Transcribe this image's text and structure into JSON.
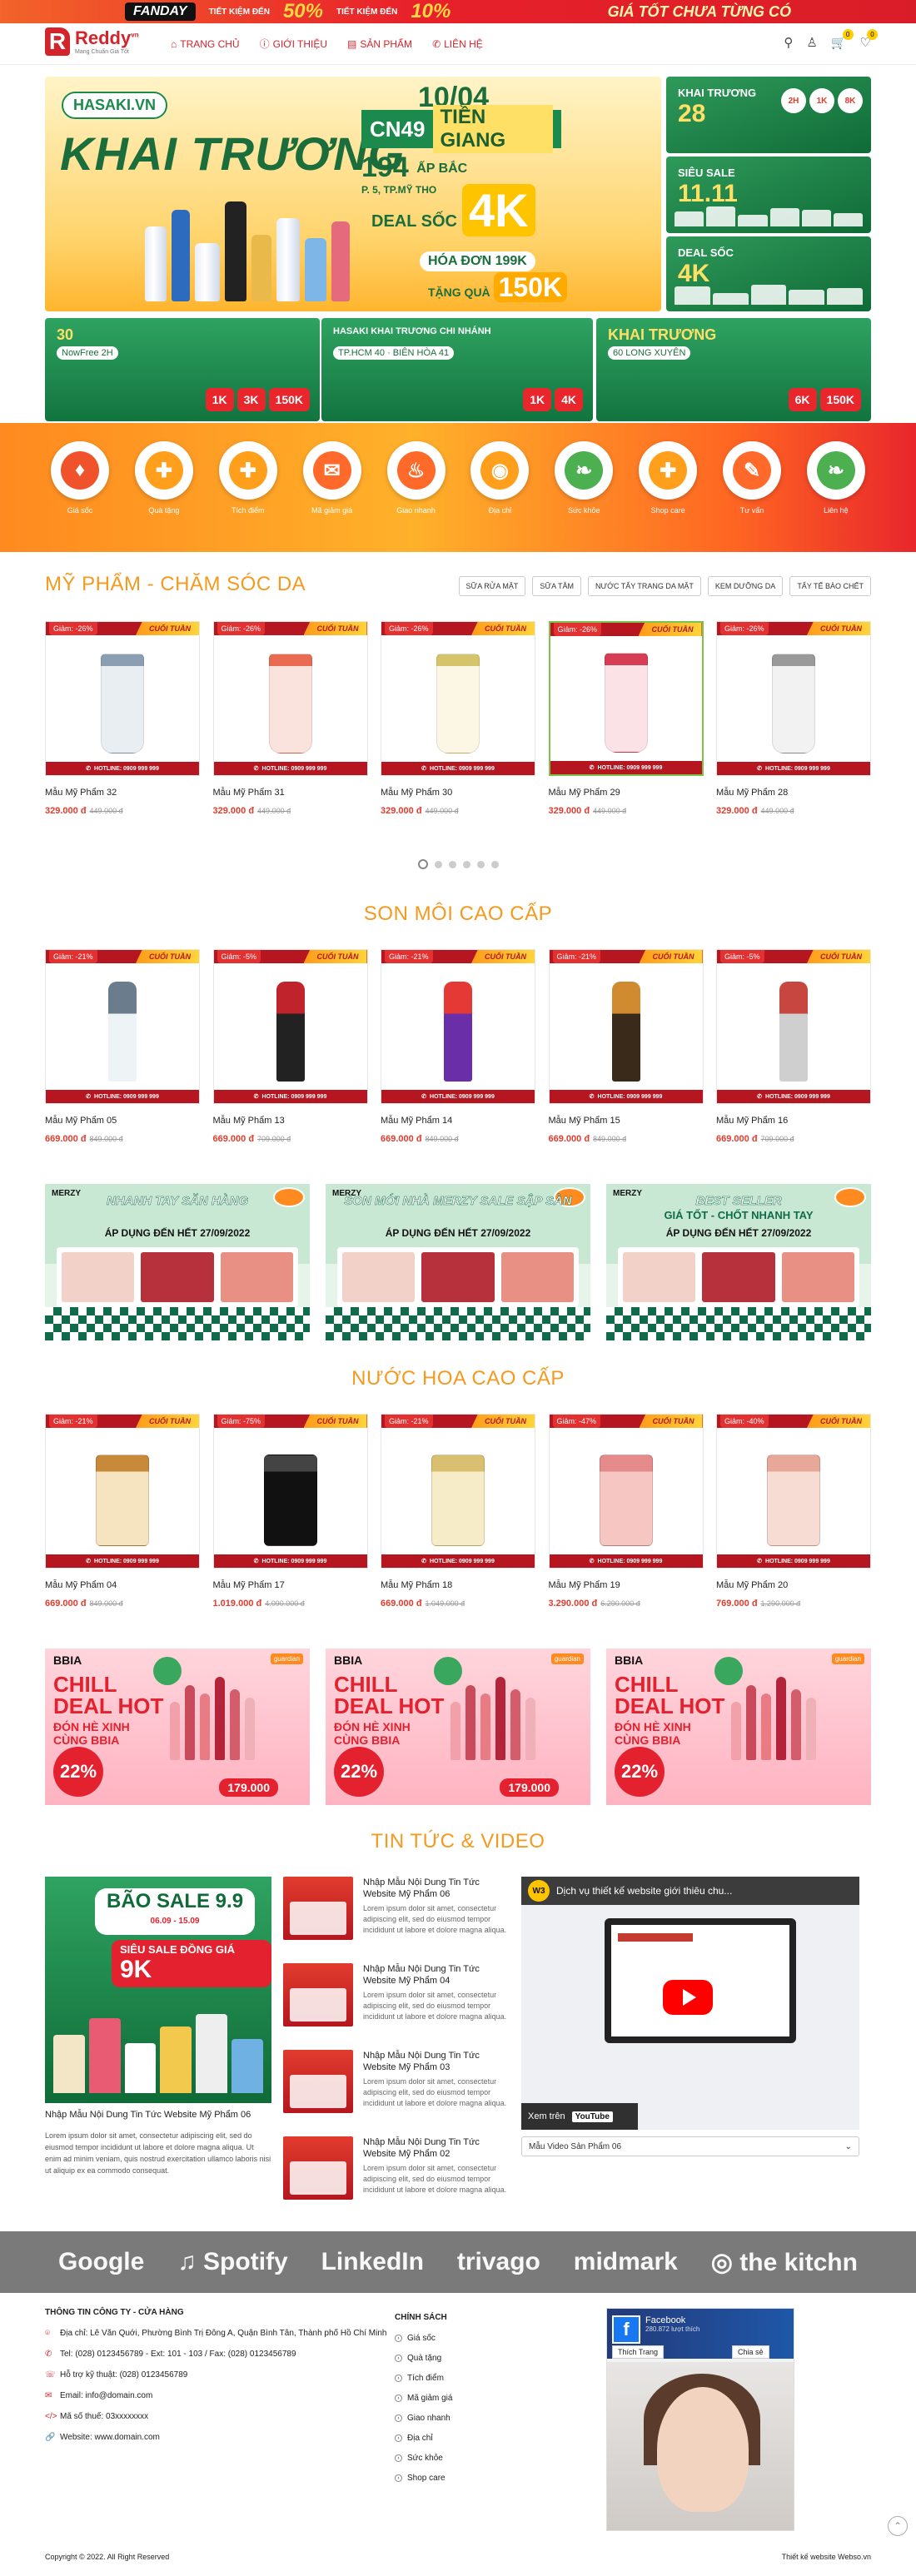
{
  "topbar": {
    "fanday": "FANDAY",
    "deal1": "50%",
    "deal1_note": "TIẾT KIỆM\nĐẾN",
    "deal2": "10%",
    "deal2_note": "TIẾT KIỆM\nĐẾN",
    "slogan": "GIÁ TỐT CHƯA TỪNG CÓ"
  },
  "header": {
    "logo_letter": "R",
    "logo_name": "Reddy",
    "logo_tld": "vn",
    "logo_sub": "Mang Chuẩn Giá Tốt",
    "nav": [
      {
        "label": "TRANG CHỦ",
        "icon": "⌂"
      },
      {
        "label": "GIỚI THIỆU",
        "icon": "ⓘ"
      },
      {
        "label": "SẢN PHẨM",
        "icon": "▤"
      },
      {
        "label": "LIÊN HỆ",
        "icon": "✆"
      }
    ],
    "cart_count": "0",
    "wish_count": "0"
  },
  "hero": {
    "brand": "HASAKI.VN",
    "title": "KHAI TRƯƠNG",
    "date": "10/04",
    "branch": "CN49",
    "street": "TIỀN GIANG",
    "addr_no": "194",
    "addr": "ẤP BẮC",
    "addr_sub": "P. 5, TP.MỸ THO",
    "deal_label": "DEAL SỐC",
    "deal_value": "4K",
    "bill": "HÓA ĐƠN 199K",
    "gift_label": "TẶNG QUÀ",
    "gift_value": "150K",
    "side1_title": "KHAI TRƯƠNG",
    "side1_num": "28",
    "side1_chips": [
      "2H",
      "1K",
      "8K"
    ],
    "side2_title": "SIÊU SALE",
    "side2_num": "11.11",
    "side3_title": "DEAL SỐC",
    "side3_num": "4K",
    "b1_title": "30",
    "b1_sub": "NowFree 2H",
    "b1_prices": [
      "1K",
      "3K",
      "150K"
    ],
    "b2_title": "HASAKI KHAI TRƯƠNG CHI NHÁNH",
    "b2_sub": "TP.HCM 40 · BIÊN HÒA 41",
    "b2_prices": [
      "1K",
      "4K"
    ],
    "b3_title": "KHAI TRƯƠNG",
    "b3_sub": "60 LONG XUYÊN",
    "b3_prices": [
      "6K",
      "150K"
    ]
  },
  "categories": [
    {
      "label": "Giá sốc",
      "glyph": "♦",
      "color": "#f0532b"
    },
    {
      "label": "Quà tặng",
      "glyph": "✚",
      "color": "#ff9f1c"
    },
    {
      "label": "Tích điểm",
      "glyph": "✚",
      "color": "#ff9f1c"
    },
    {
      "label": "Mã giảm giá",
      "glyph": "✉",
      "color": "#ff6a2a"
    },
    {
      "label": "Giao nhanh",
      "glyph": "♨",
      "color": "#ff6a2a"
    },
    {
      "label": "Địa chỉ",
      "glyph": "◉",
      "color": "#ff9f1c"
    },
    {
      "label": "Sức khỏe",
      "glyph": "❧",
      "color": "#4caf50"
    },
    {
      "label": "Shop care",
      "glyph": "✚",
      "color": "#ff9f1c"
    },
    {
      "label": "Tư vấn",
      "glyph": "✎",
      "color": "#ff6a2a"
    },
    {
      "label": "Liên hệ",
      "glyph": "❧",
      "color": "#4caf50"
    }
  ],
  "promo": {
    "week": "CUỐI TUẦN",
    "hotline": "HOTLINE: 0909 999 999"
  },
  "sec_cosmetics": {
    "title": "MỸ PHẨM - CHĂM SÓC DA",
    "tabs": [
      "SỮA RỬA MẶT",
      "SỮA TẮM",
      "NƯỚC TẨY TRANG DA MẶT",
      "KEM DƯỠNG DA",
      "TẨY TẾ BÀO CHẾT"
    ],
    "items": [
      {
        "disc": "Giảm: -26%",
        "name": "Mẫu Mỹ Phẩm 32",
        "price": "329.000 đ",
        "old": "449.000 đ",
        "c1": "#e9eef3",
        "c2": "#8aa0b2"
      },
      {
        "disc": "Giảm: -26%",
        "name": "Mẫu Mỹ Phẩm 31",
        "price": "329.000 đ",
        "old": "449.000 đ",
        "c1": "#fbe3dd",
        "c2": "#e96b52"
      },
      {
        "disc": "Giảm: -26%",
        "name": "Mẫu Mỹ Phẩm 30",
        "price": "329.000 đ",
        "old": "449.000 đ",
        "c1": "#fbf7e4",
        "c2": "#d6c46b"
      },
      {
        "disc": "Giảm: -26%",
        "name": "Mẫu Mỹ Phẩm 29",
        "price": "329.000 đ",
        "old": "449.000 đ",
        "c1": "#fbe2e6",
        "c2": "#d73c55"
      },
      {
        "disc": "Giảm: -26%",
        "name": "Mẫu Mỹ Phẩm 28",
        "price": "329.000 đ",
        "old": "449.000 đ",
        "c1": "#f2f2f2",
        "c2": "#9a9a9a"
      }
    ]
  },
  "sec_lips": {
    "title": "SON MÔI CAO CẤP",
    "items": [
      {
        "disc": "Giảm: -21%",
        "name": "Mẫu Mỹ Phẩm 05",
        "price": "669.000 đ",
        "old": "849.000 đ",
        "c1": "#eef3f6",
        "c2": "#6b7d8c"
      },
      {
        "disc": "Giảm: -5%",
        "name": "Mẫu Mỹ Phẩm 13",
        "price": "669.000 đ",
        "old": "709.000 đ",
        "c1": "#222222",
        "c2": "#c0232c"
      },
      {
        "disc": "Giảm: -21%",
        "name": "Mẫu Mỹ Phẩm 14",
        "price": "669.000 đ",
        "old": "849.000 đ",
        "c1": "#6a2ea8",
        "c2": "#e53935"
      },
      {
        "disc": "Giảm: -21%",
        "name": "Mẫu Mỹ Phẩm 15",
        "price": "669.000 đ",
        "old": "849.000 đ",
        "c1": "#3a2a1a",
        "c2": "#d08a2f"
      },
      {
        "disc": "Giảm: -5%",
        "name": "Mẫu Mỹ Phẩm 16",
        "price": "669.000 đ",
        "old": "709.000 đ",
        "c1": "#cfcfcf",
        "c2": "#c7463f"
      }
    ]
  },
  "merzy": [
    {
      "brand": "MERZY",
      "head": "NHANH TAY SĂN HÀNG",
      "head2": "",
      "apply": "ÁP DỤNG ĐẾN HẾT 27/09/2022",
      "bg": "#c9e8d3"
    },
    {
      "brand": "MERZY",
      "head": "SON MỚI NHÀ MERZY SALE SẬP SÀN",
      "head2": "",
      "apply": "ÁP DỤNG ĐẾN HẾT 27/09/2022",
      "bg": "#c9e8d3"
    },
    {
      "brand": "MERZY",
      "head": "BEST SELLER",
      "head2": "GIÁ TỐT - CHỐT NHANH TAY",
      "apply": "ÁP DỤNG ĐẾN HẾT 27/09/2022",
      "bg": "#c9e8d3"
    }
  ],
  "sec_perfume": {
    "title": "NƯỚC HOA CAO CẤP",
    "items": [
      {
        "disc": "Giảm: -21%",
        "name": "Mẫu Mỹ Phẩm 04",
        "price": "669.000 đ",
        "old": "849.000 đ",
        "c1": "#f6e3bf",
        "c2": "#c88a3a"
      },
      {
        "disc": "Giảm: -75%",
        "name": "Mẫu Mỹ Phẩm 17",
        "price": "1.019.000 đ",
        "old": "4.090.000 đ",
        "c1": "#111111",
        "c2": "#444444"
      },
      {
        "disc": "Giảm: -21%",
        "name": "Mẫu Mỹ Phẩm 18",
        "price": "669.000 đ",
        "old": "1.049.000 đ",
        "c1": "#f7ecc8",
        "c2": "#d9c071"
      },
      {
        "disc": "Giảm: -47%",
        "name": "Mẫu Mỹ Phẩm 19",
        "price": "3.290.000 đ",
        "old": "6.290.000 đ",
        "c1": "#f6c6c3",
        "c2": "#e68b8b"
      },
      {
        "disc": "Giảm: -40%",
        "name": "Mẫu Mỹ Phẩm 20",
        "price": "769.000 đ",
        "old": "1.290.000 đ",
        "c1": "#f7dcd3",
        "c2": "#e8a899"
      }
    ]
  },
  "bbia": [
    {
      "brand": "BBIA",
      "guardian": "guardian",
      "l1": "CHILL",
      "l2": "DEAL HOT",
      "l3": "ĐÓN HÈ XINH",
      "l4": "CÙNG BBIA",
      "save": "22%",
      "price": "179.000"
    },
    {
      "brand": "BBIA",
      "guardian": "guardian",
      "l1": "CHILL",
      "l2": "DEAL HOT",
      "l3": "ĐÓN HÈ XINH",
      "l4": "CÙNG BBIA",
      "save": "22%",
      "price": "179.000"
    },
    {
      "brand": "BBIA",
      "guardian": "guardian",
      "l1": "CHILL",
      "l2": "DEAL HOT",
      "l3": "ĐÓN HÈ XINH",
      "l4": "CÙNG BBIA",
      "save": "22%",
      "price": ""
    }
  ],
  "news": {
    "title": "TIN TỨC & VIDEO",
    "main": {
      "sale": "BÃO SALE 9.9",
      "sale_date": "06.09 - 15.09",
      "k_label": "SIÊU SALE ĐỒNG GIÁ",
      "k_value": "9K",
      "title": "Nhập Mẫu Nội Dung Tin Tức Website Mỹ Phẩm 06",
      "desc": "Lorem ipsum dolor sit amet, consectetur adipiscing elit, sed do eiusmod tempor incididunt ut labore et dolore magna aliqua. Ut enim ad minim veniam, quis nostrud exercitation ullamco laboris nisi ut aliquip ex ea commodo consequat."
    },
    "list": [
      {
        "title": "Nhập Mẫu Nội Dung Tin Tức Website Mỹ Phẩm 06",
        "desc": "Lorem ipsum dolor sit amet, consectetur adipiscing elit, sed do eiusmod tempor incididunt ut labore et dolore magna aliqua."
      },
      {
        "title": "Nhập Mẫu Nội Dung Tin Tức Website Mỹ Phẩm 04",
        "desc": "Lorem ipsum dolor sit amet, consectetur adipiscing elit, sed do eiusmod tempor incididunt ut labore et dolore magna aliqua."
      },
      {
        "title": "Nhập Mẫu Nội Dung Tin Tức Website Mỹ Phẩm 03",
        "desc": "Lorem ipsum dolor sit amet, consectetur adipiscing elit, sed do eiusmod tempor incididunt ut labore et dolore magna aliqua."
      },
      {
        "title": "Nhập Mẫu Nội Dung Tin Tức Website Mỹ Phẩm 02",
        "desc": "Lorem ipsum dolor sit amet, consectetur adipiscing elit, sed do eiusmod tempor incididunt ut labore et dolore magna aliqua."
      }
    ],
    "video_avatar": "W3",
    "video_title": "Dịch vụ thiết kế website giới thiêu chu...",
    "video_watch": "Xem trên",
    "video_yt": "YouTube",
    "video_select": "Mẫu Video Sản Phẩm 06"
  },
  "partners": [
    "Google",
    "♫ Spotify",
    "LinkedIn",
    "trivago",
    "midmark",
    "◎ the kitchn"
  ],
  "footer": {
    "company_title": "THÔNG TIN CÔNG TY - CỬA HÀNG",
    "address": "Địa chỉ: Lê Văn Quới, Phường Bình Trị Đông A, Quận Bình Tân, Thành phố Hồ Chí Minh",
    "tel": "Tel: (028) 0123456789 - Ext: 101 - 103  /  Fax: (028) 0123456789",
    "support": "Hỗ trợ kỹ thuật: (028) 0123456789",
    "email": "Email: info@domain.com",
    "tax": "Mã số thuế: 03xxxxxxxx",
    "website": "Website: www.domain.com",
    "policy_title": "CHÍNH SÁCH",
    "policies": [
      "Giá sốc",
      "Quà tặng",
      "Tích điểm",
      "Mã giảm giá",
      "Giao nhanh",
      "Địa chỉ",
      "Sức khỏe",
      "Shop care"
    ],
    "fb_name": "Facebook",
    "fb_sub": "280.872 lượt thích",
    "fb_like": "Thích Trang",
    "fb_share": "Chia sẻ",
    "copyright": "Copyright © 2022. All Right Reserved",
    "credit": "Thiết kế website Webso.vn"
  }
}
